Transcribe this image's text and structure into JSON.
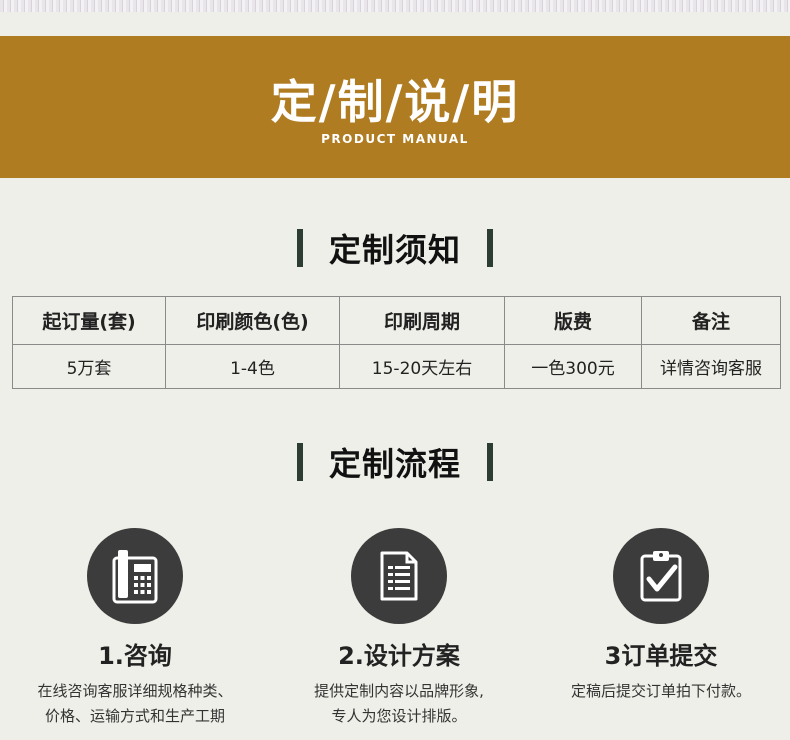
{
  "banner": {
    "title": "定/制/说/明",
    "subtitle": "PRODUCT MANUAL",
    "color": "#b07c22"
  },
  "notice": {
    "title": "定制须知",
    "headers": [
      "起订量(套)",
      "印刷颜色(色)",
      "印刷周期",
      "版费",
      "备注"
    ],
    "values": [
      "5万套",
      "1-4色",
      "15-20天左右",
      "一色300元",
      "详情咨询客服"
    ]
  },
  "process": {
    "title": "定制流程",
    "steps": [
      {
        "icon": "phone-icon",
        "title": "1.咨询",
        "desc": [
          "在线咨询客服详细规格种类、",
          "价格、运输方式和生产工期"
        ]
      },
      {
        "icon": "document-icon",
        "title": "2.设计方案",
        "desc": [
          "提供定制内容以品牌形象,",
          "专人为您设计排版。"
        ]
      },
      {
        "icon": "clipboard-check-icon",
        "title": "3订单提交",
        "desc": [
          "定稿后提交订单拍下付款。"
        ]
      }
    ]
  }
}
